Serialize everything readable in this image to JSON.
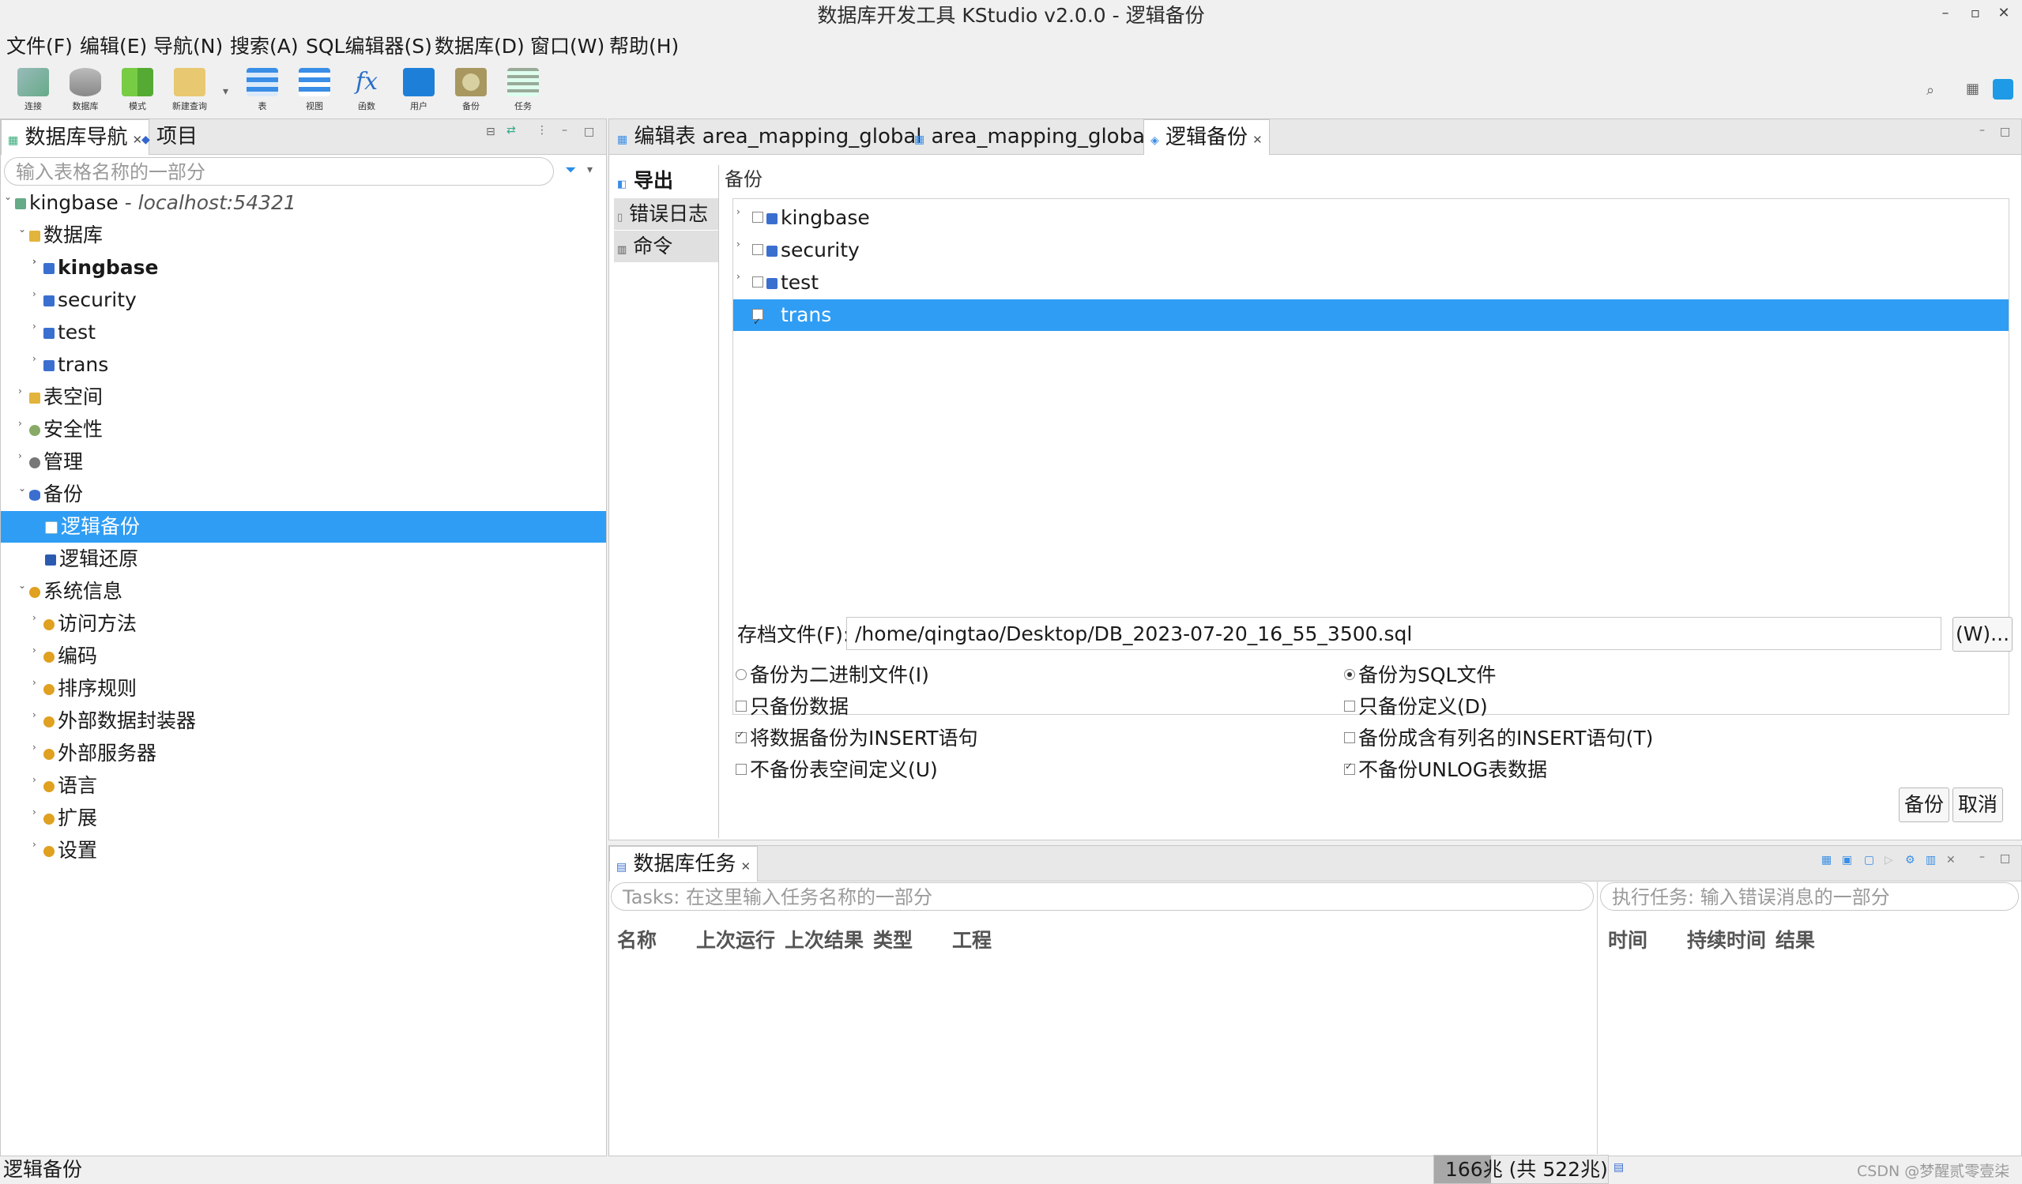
{
  "window": {
    "title": "数据库开发工具 KStudio v2.0.0 - 逻辑备份"
  },
  "menu": [
    "文件(F)",
    "编辑(E)",
    "导航(N)",
    "搜索(A)",
    "SQL编辑器(S)",
    "数据库(D)",
    "窗口(W)",
    "帮助(H)"
  ],
  "toolbar": [
    "连接",
    "数据库",
    "模式",
    "新建查询",
    "表",
    "视图",
    "函数",
    "用户",
    "备份",
    "任务"
  ],
  "left": {
    "tabs": [
      "数据库导航",
      "项目"
    ],
    "filter_placeholder": "输入表格名称的一部分",
    "tree": [
      {
        "label": "kingbase",
        "host": " - localhost:54321"
      },
      {
        "label": "数据库"
      },
      {
        "label": "kingbase"
      },
      {
        "label": "security"
      },
      {
        "label": "test"
      },
      {
        "label": "trans"
      },
      {
        "label": "表空间"
      },
      {
        "label": "安全性"
      },
      {
        "label": "管理"
      },
      {
        "label": "备份"
      },
      {
        "label": "逻辑备份"
      },
      {
        "label": "逻辑还原"
      },
      {
        "label": "系统信息"
      },
      {
        "label": "访问方法"
      },
      {
        "label": "编码"
      },
      {
        "label": "排序规则"
      },
      {
        "label": "外部数据封装器"
      },
      {
        "label": "外部服务器"
      },
      {
        "label": "语言"
      },
      {
        "label": "扩展"
      },
      {
        "label": "设置"
      }
    ]
  },
  "editor": {
    "tabs": [
      "编辑表 area_mapping_global",
      "area_mapping_global",
      "逻辑备份"
    ],
    "side_tabs": [
      "导出",
      "错误日志",
      "命令"
    ],
    "section_label": "备份",
    "db_list": [
      "kingbase",
      "security",
      "test",
      "trans"
    ],
    "file_label": "存档文件(F):",
    "file_value": "/home/qingtao/Desktop/DB_2023-07-20_16_55_3500.sql",
    "browse_button": "(W)...",
    "options_left": [
      "备份为二进制文件(I)",
      "只备份数据",
      "将数据备份为INSERT语句",
      "不备份表空间定义(U)"
    ],
    "options_right": [
      "备份为SQL文件",
      "只备份定义(D)",
      "备份成含有列名的INSERT语句(T)",
      "不备份UNLOG表数据"
    ],
    "backup_button": "备份",
    "cancel_button": "取消"
  },
  "tasks": {
    "tab": "数据库任务",
    "filter_placeholder": "Tasks: 在这里输入任务名称的一部分",
    "exec_placeholder": "执行任务: 输入错误消息的一部分",
    "columns": [
      "名称",
      "上次运行",
      "上次结果",
      "类型",
      "工程"
    ],
    "exec_columns": [
      "时间",
      "持续时间",
      "结果"
    ]
  },
  "status": {
    "left": "逻辑备份",
    "memory": "166兆 (共 522兆)",
    "watermark": "CSDN @梦醒贰零壹柒"
  }
}
